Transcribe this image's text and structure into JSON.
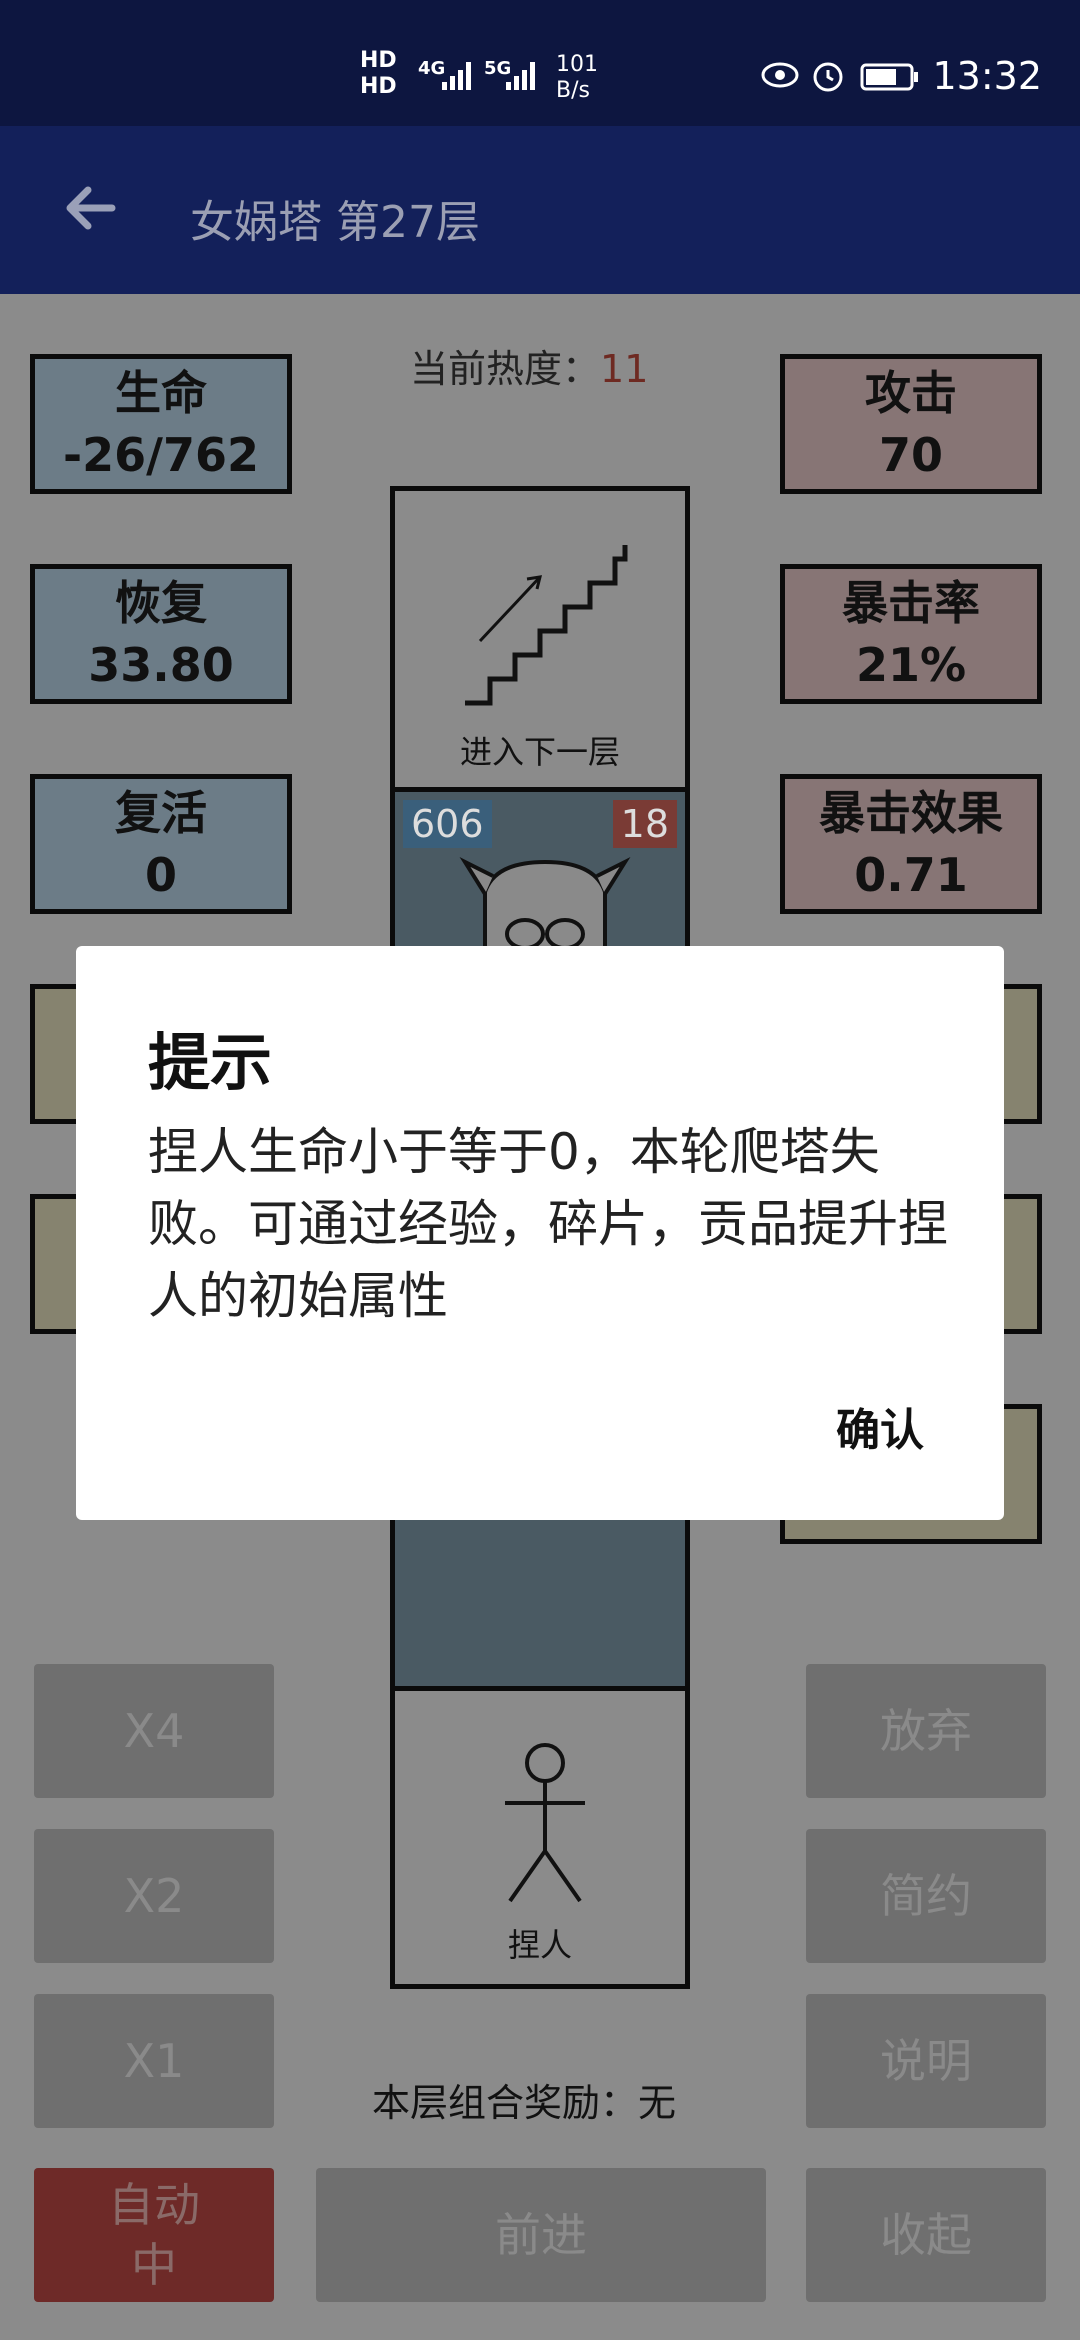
{
  "status_bar": {
    "hd1": "HD",
    "hd2": "HD",
    "sim1_network": "4G",
    "sim2_network": "5G",
    "speed_value": "101",
    "speed_unit": "B/s",
    "time": "13:32",
    "icons": [
      "eye-icon",
      "alarm-icon",
      "battery-icon"
    ]
  },
  "app_bar": {
    "title": "女娲塔 第27层",
    "back_icon": "arrow-left-icon"
  },
  "heat": {
    "label": "当前热度：",
    "value": "11"
  },
  "left_stats": [
    {
      "label": "生命",
      "value": "-26/762"
    },
    {
      "label": "恢复",
      "value": "33.80"
    },
    {
      "label": "复活",
      "value": "0"
    }
  ],
  "right_stats": [
    {
      "label": "攻击",
      "value": "70"
    },
    {
      "label": "暴击率",
      "value": "21%"
    },
    {
      "label": "暴击效果",
      "value": "0.71"
    }
  ],
  "tower": {
    "stairs_label": "进入下一层",
    "monster_hp": "606",
    "monster_atk": "18",
    "player_label": "捏人"
  },
  "left_buttons": [
    "X4",
    "X2",
    "X1"
  ],
  "auto_button": {
    "line1": "自动",
    "line2": "中"
  },
  "forward_button": "前进",
  "right_buttons": [
    "放弃",
    "简约",
    "说明",
    "收起"
  ],
  "reward": {
    "label": "本层组合奖励：",
    "value": "无"
  },
  "dialog": {
    "title": "提示",
    "message": "捏人生命小于等于0，本轮爬塔失败。可通过经验，碎片，贡品提升捏人的初始属性",
    "confirm_label": "确认"
  },
  "colors": {
    "status_bar_bg": "#0d1640",
    "app_bar_bg": "#13205a",
    "auto_button_bg": "#6e2a28",
    "heat_value": "#6e2a22"
  }
}
